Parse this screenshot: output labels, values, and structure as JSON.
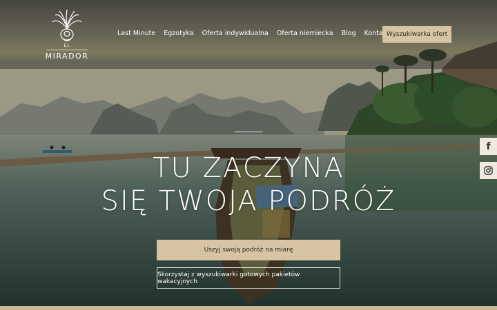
{
  "brand": {
    "el": "EL",
    "name": "MIRADOR"
  },
  "nav": {
    "items": [
      {
        "label": "Last Minute"
      },
      {
        "label": "Egzotyka"
      },
      {
        "label": "Oferta indywidualna"
      },
      {
        "label": "Oferta niemiecka"
      },
      {
        "label": "Blog"
      },
      {
        "label": "Kontakt"
      }
    ],
    "cta_label": "Wyszukiwarka ofert"
  },
  "hero": {
    "headline_line1": "TU ZACZYNA",
    "headline_line2": "SIĘ TWOJA PODRÓŻ",
    "primary_button": "Uszyj swoją podróż na miarę",
    "secondary_button": "Skorzystaj z wyszukiwarki gotowych pakietów wakacyjnych"
  },
  "social": {
    "facebook_icon": "facebook-icon",
    "instagram_icon": "instagram-icon"
  },
  "colors": {
    "accent": "#d6c4a2",
    "header_overlay": "rgba(40,40,36,0.45)"
  }
}
